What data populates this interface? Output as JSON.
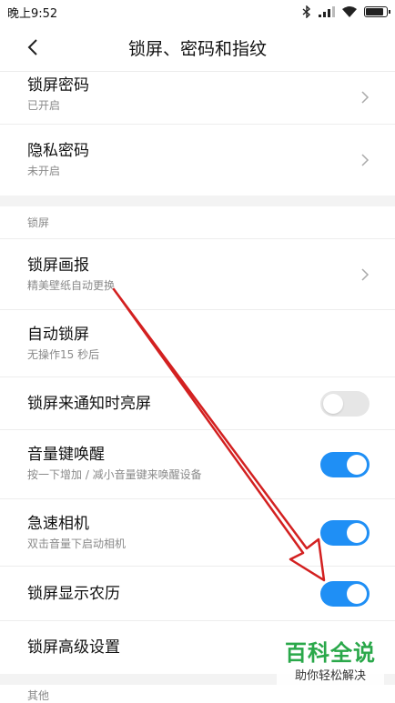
{
  "status_bar": {
    "time": "晚上9:52"
  },
  "header": {
    "title": "锁屏、密码和指纹"
  },
  "section1": {
    "items": [
      {
        "title": "锁屏密码",
        "subtitle": "已开启"
      },
      {
        "title": "隐私密码",
        "subtitle": "未开启"
      }
    ]
  },
  "section2": {
    "header": "锁屏",
    "items": [
      {
        "title": "锁屏画报",
        "subtitle": "精美壁纸自动更换"
      },
      {
        "title": "自动锁屏",
        "subtitle": "无操作15 秒后"
      },
      {
        "title": "锁屏来通知时亮屏",
        "toggle": false
      },
      {
        "title": "音量键唤醒",
        "subtitle": "按一下增加 / 减小音量键来唤醒设备",
        "toggle": true
      },
      {
        "title": "急速相机",
        "subtitle": "双击音量下启动相机",
        "toggle": true
      },
      {
        "title": "锁屏显示农历",
        "toggle": true
      },
      {
        "title": "锁屏高级设置"
      }
    ]
  },
  "section3": {
    "header": "其他"
  },
  "watermark": {
    "main": "百科全说",
    "sub": "助你轻松解决"
  },
  "colors": {
    "toggle_on": "#1f8ff5",
    "toggle_off": "#e6e6e6",
    "arrow": "#d32020",
    "watermark": "#2aa84a"
  },
  "icons": [
    "back-arrow-icon",
    "chevron-right-icon",
    "bluetooth-icon",
    "signal-icon",
    "wifi-icon",
    "battery-icon"
  ]
}
